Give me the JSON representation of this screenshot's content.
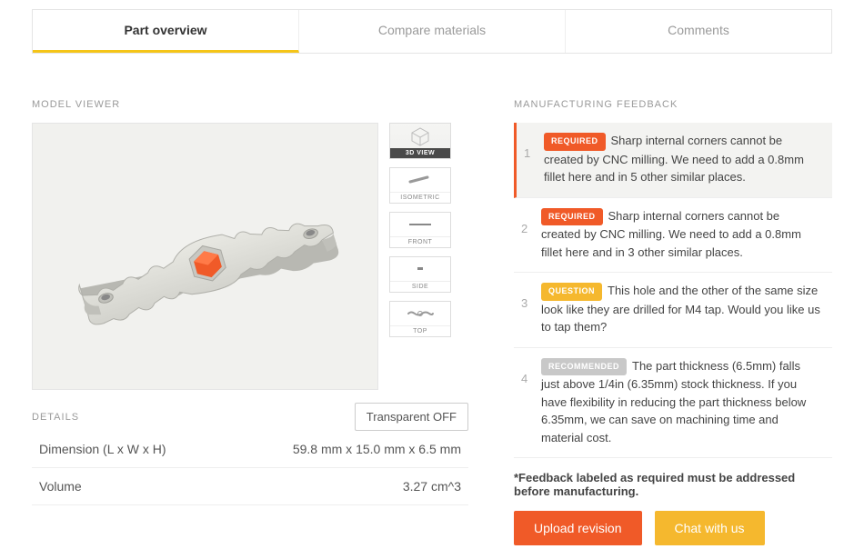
{
  "tabs": {
    "overview": "Part overview",
    "compare": "Compare materials",
    "comments": "Comments"
  },
  "viewer": {
    "label": "MODEL VIEWER",
    "views": {
      "threed": "3D VIEW",
      "isometric": "ISOMETRIC",
      "front": "FRONT",
      "side": "SIDE",
      "top": "TOP"
    }
  },
  "details": {
    "label": "DETAILS",
    "transparent": "Transparent OFF",
    "dimension_label": "Dimension (L x W x H)",
    "dimension_value": "59.8 mm x 15.0 mm x 6.5 mm",
    "volume_label": "Volume",
    "volume_value": "3.27 cm^3"
  },
  "feedback": {
    "label": "MANUFACTURING FEEDBACK",
    "badges": {
      "required": "REQUIRED",
      "question": "QUESTION",
      "recommended": "RECOMMENDED"
    },
    "items": [
      {
        "n": "1",
        "badge": "required",
        "text": "Sharp internal corners cannot be created by CNC milling. We need to add a 0.8mm fillet here and in 5 other similar places."
      },
      {
        "n": "2",
        "badge": "required",
        "text": "Sharp internal corners cannot be created by CNC milling. We need to add a 0.8mm fillet here and in 3 other similar places."
      },
      {
        "n": "3",
        "badge": "question",
        "text": "This hole and the other of the same size look like they are drilled for M4 tap. Would you like us to tap them?"
      },
      {
        "n": "4",
        "badge": "recommended",
        "text": "The part thickness (6.5mm) falls just above 1/4in (6.35mm) stock thickness. If you have flexibility in reducing the part thickness below 6.35mm, we can save on machining time and material cost."
      }
    ],
    "footnote": "*Feedback labeled as required must be addressed before manufacturing.",
    "upload": "Upload revision",
    "chat": "Chat with us"
  }
}
